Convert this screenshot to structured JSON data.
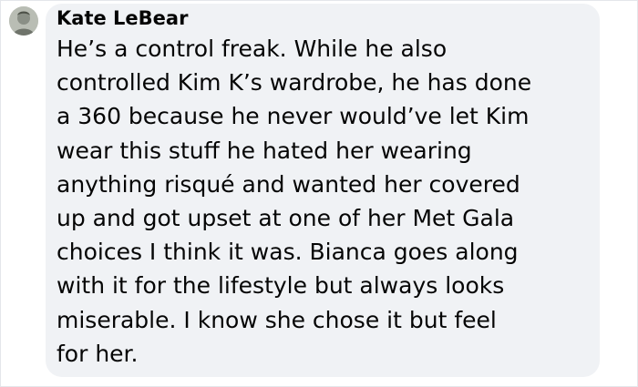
{
  "comment": {
    "author_name": "Kate LeBear",
    "lines": [
      "He’s a control freak. While he also",
      "controlled Kim K’s wardrobe, he has done",
      "a 360 because he never would’ve let Kim",
      "wear this stuff he hated her wearing",
      "anything risqué and wanted her covered",
      "up and got upset at one of her Met Gala",
      "choices I think it was. Bianca goes along",
      "with it for the lifestyle but always looks",
      "miserable. I know she chose it but feel",
      "for her."
    ]
  },
  "colors": {
    "bubble_background": "#f0f2f5",
    "text": "#050505"
  },
  "icons": {
    "avatar": "profile-photo"
  }
}
